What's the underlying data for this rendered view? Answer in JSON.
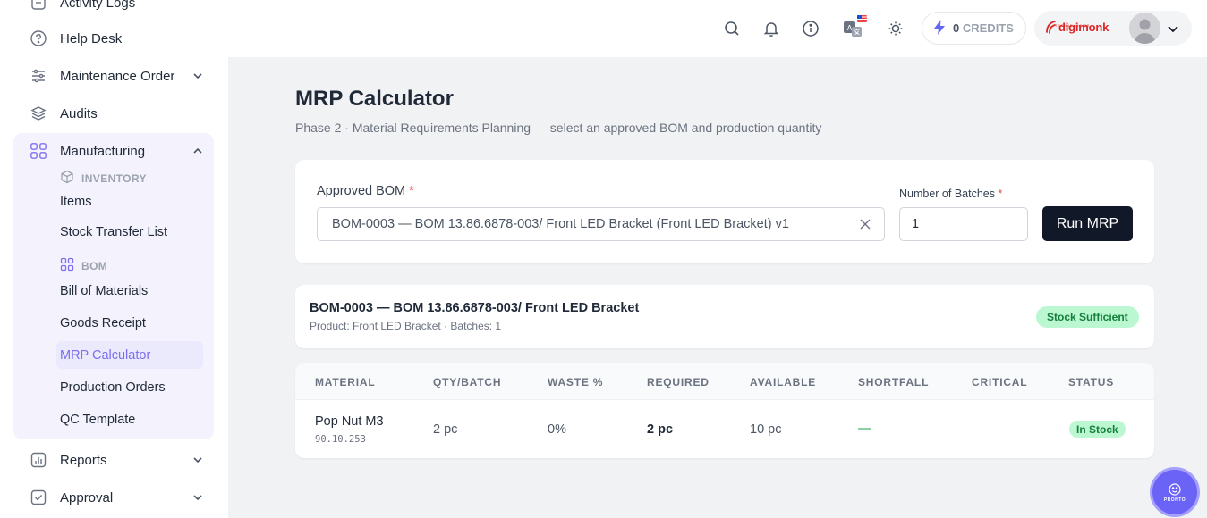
{
  "sidebar": {
    "activity_logs": "Activity Logs",
    "help_desk": "Help Desk",
    "maintenance_order": "Maintenance Order",
    "audits": "Audits",
    "manufacturing": "Manufacturing",
    "inventory_heading": "INVENTORY",
    "items": "Items",
    "stock_transfer": "Stock Transfer List",
    "bom_heading": "BOM",
    "bill_of_materials": "Bill of Materials",
    "goods_receipt": "Goods Receipt",
    "mrp_calculator": "MRP Calculator",
    "production_orders": "Production Orders",
    "qc_template": "QC Template",
    "reports": "Reports",
    "approval": "Approval"
  },
  "header": {
    "credits_count": "0",
    "credits_label": "CREDITS",
    "brand_name": "digimonk",
    "brand_sub": "TECHNOLOGIES"
  },
  "page": {
    "title": "MRP Calculator",
    "subtitle": "Phase 2 · Material Requirements Planning — select an approved BOM and production quantity"
  },
  "form": {
    "bom_label": "Approved BOM",
    "required_mark": "*",
    "bom_value": "BOM-0003 — BOM 13.86.6878-003/ Front LED Bracket (Front LED Bracket) v1",
    "batches_label": "Number of Batches",
    "batches_value": "1",
    "run_label": "Run MRP"
  },
  "summary": {
    "title": "BOM-0003 — BOM 13.86.6878-003/ Front LED Bracket",
    "meta": "Product: Front LED Bracket · Batches: 1",
    "status": "Stock Sufficient"
  },
  "table": {
    "headers": [
      "MATERIAL",
      "QTY/BATCH",
      "WASTE %",
      "REQUIRED",
      "AVAILABLE",
      "SHORTFALL",
      "CRITICAL",
      "STATUS"
    ],
    "rows": [
      {
        "material": "Pop Nut M3",
        "code": "90.10.253",
        "qty_batch": "2 pc",
        "waste": "0%",
        "required": "2 pc",
        "available": "10 pc",
        "shortfall": "—",
        "critical": "",
        "status": "In Stock"
      }
    ]
  },
  "fab": {
    "label": "PRONTO"
  },
  "colors": {
    "accent": "#7c6ff0",
    "success_bg": "#bbf7d0",
    "success_text": "#15803d",
    "primary_button": "#111827"
  }
}
